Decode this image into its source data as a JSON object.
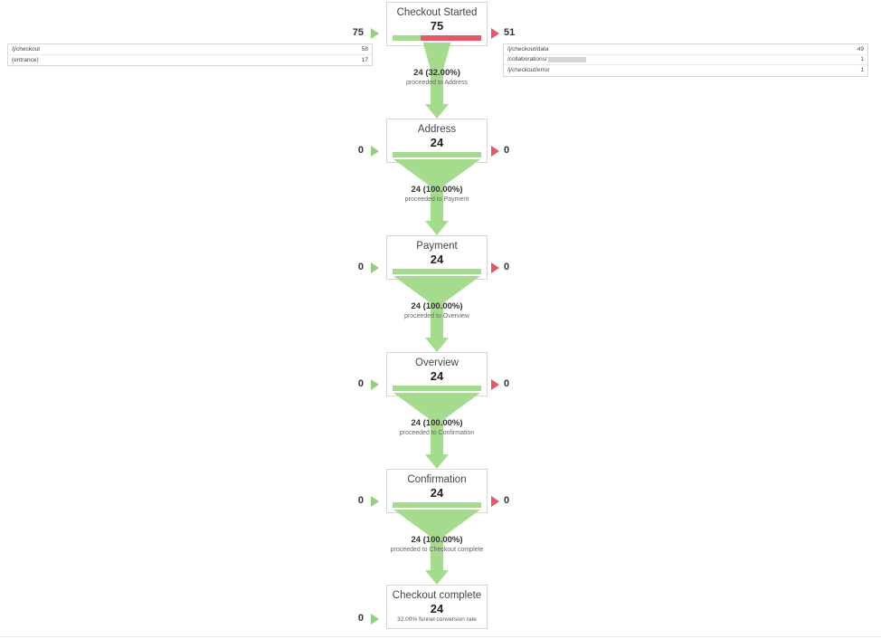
{
  "funnel": {
    "conversion_note": "32.00% funnel conversion rate",
    "stages": [
      {
        "name": "Checkout Started",
        "value": "75",
        "entries": "75",
        "exits": "51",
        "bar_green_pct": 32,
        "bar_red_pct": 68,
        "flow_main": "24 (32.00%)",
        "flow_sub": "proceeded to Address"
      },
      {
        "name": "Address",
        "value": "24",
        "entries": "0",
        "exits": "0",
        "bar_green_pct": 100,
        "bar_red_pct": 0,
        "flow_main": "24 (100.00%)",
        "flow_sub": "proceeded to Payment"
      },
      {
        "name": "Payment",
        "value": "24",
        "entries": "0",
        "exits": "0",
        "bar_green_pct": 100,
        "bar_red_pct": 0,
        "flow_main": "24 (100.00%)",
        "flow_sub": "proceeded to Overview"
      },
      {
        "name": "Overview",
        "value": "24",
        "entries": "0",
        "exits": "0",
        "bar_green_pct": 100,
        "bar_red_pct": 0,
        "flow_main": "24 (100.00%)",
        "flow_sub": "proceeded to Confirmation"
      },
      {
        "name": "Confirmation",
        "value": "24",
        "entries": "0",
        "exits": "0",
        "bar_green_pct": 100,
        "bar_red_pct": 0,
        "flow_main": "24 (100.00%)",
        "flow_sub": "proceeded to Checkout complete"
      },
      {
        "name": "Checkout complete",
        "value": "24",
        "entries": "0",
        "exits": null,
        "bar_green_pct": 0,
        "bar_red_pct": 0,
        "flow_main": null,
        "flow_sub": null
      }
    ]
  },
  "entry_table": {
    "rows": [
      {
        "label": "/j/checkout",
        "value": "58"
      },
      {
        "label": "(entrance)",
        "value": "17"
      }
    ]
  },
  "exit_table": {
    "rows": [
      {
        "label": "/j/checkout/data",
        "value": "49",
        "redacted": false
      },
      {
        "label": "/collaborations/",
        "value": "1",
        "redacted": true
      },
      {
        "label": "/j/checkout/error",
        "value": "1",
        "redacted": false
      }
    ]
  },
  "colors": {
    "green": "#A5DB8C",
    "green_marker": "#8ED47E",
    "red": "#E2596A",
    "border": "#d6d6d6",
    "text": "#333333"
  }
}
